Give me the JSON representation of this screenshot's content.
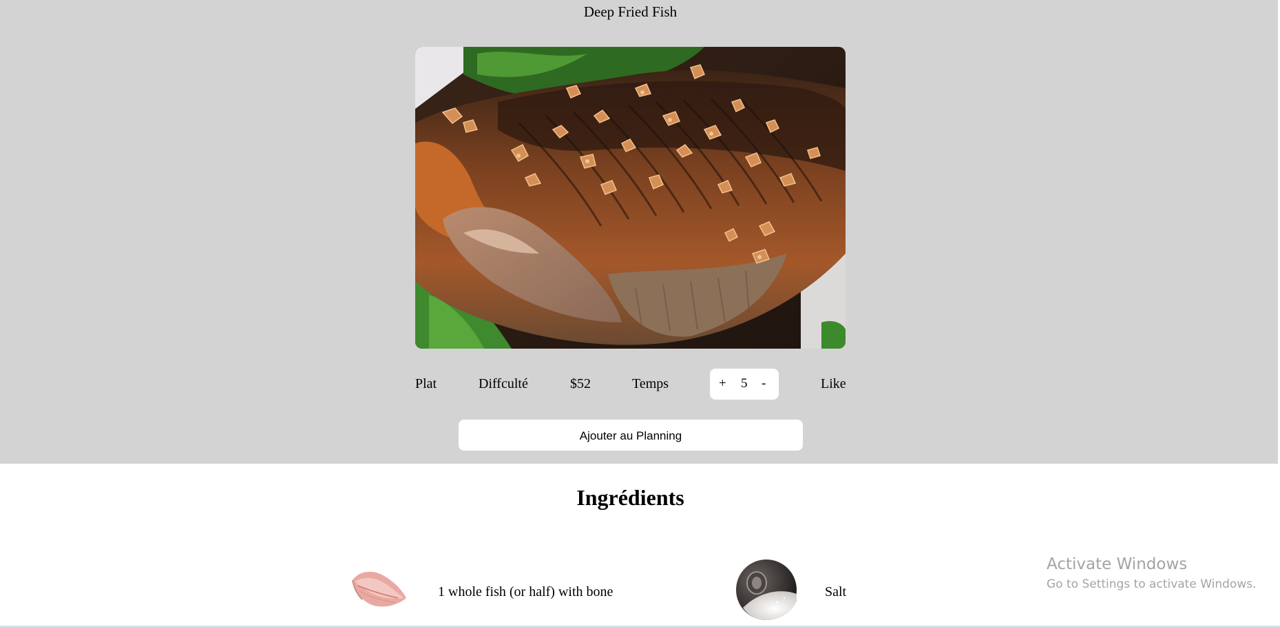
{
  "recipe": {
    "title": "Deep Fried Fish",
    "photo_icon": "fried-fish-photo"
  },
  "info": {
    "plat": "Plat",
    "difficulte": "Diffculté",
    "price": "$52",
    "temps": "Temps",
    "like": "Like"
  },
  "servings": {
    "plus": "+",
    "value": "5",
    "minus": "-"
  },
  "actions": {
    "add_to_planning": "Ajouter au Planning"
  },
  "ingredients": {
    "heading": "Ingrédients",
    "items": [
      {
        "text": "1 whole fish (or half) with bone",
        "icon": "fish-fillet-icon"
      },
      {
        "text": "Salt",
        "icon": "salt-icon"
      }
    ]
  },
  "windows_watermark": {
    "line1": "Activate Windows",
    "line2": "Go to Settings to activate Windows."
  },
  "colors": {
    "hero_bg": "#d3d3d3",
    "page_bg": "#ffffff",
    "watermark": "#a4a4a4"
  }
}
